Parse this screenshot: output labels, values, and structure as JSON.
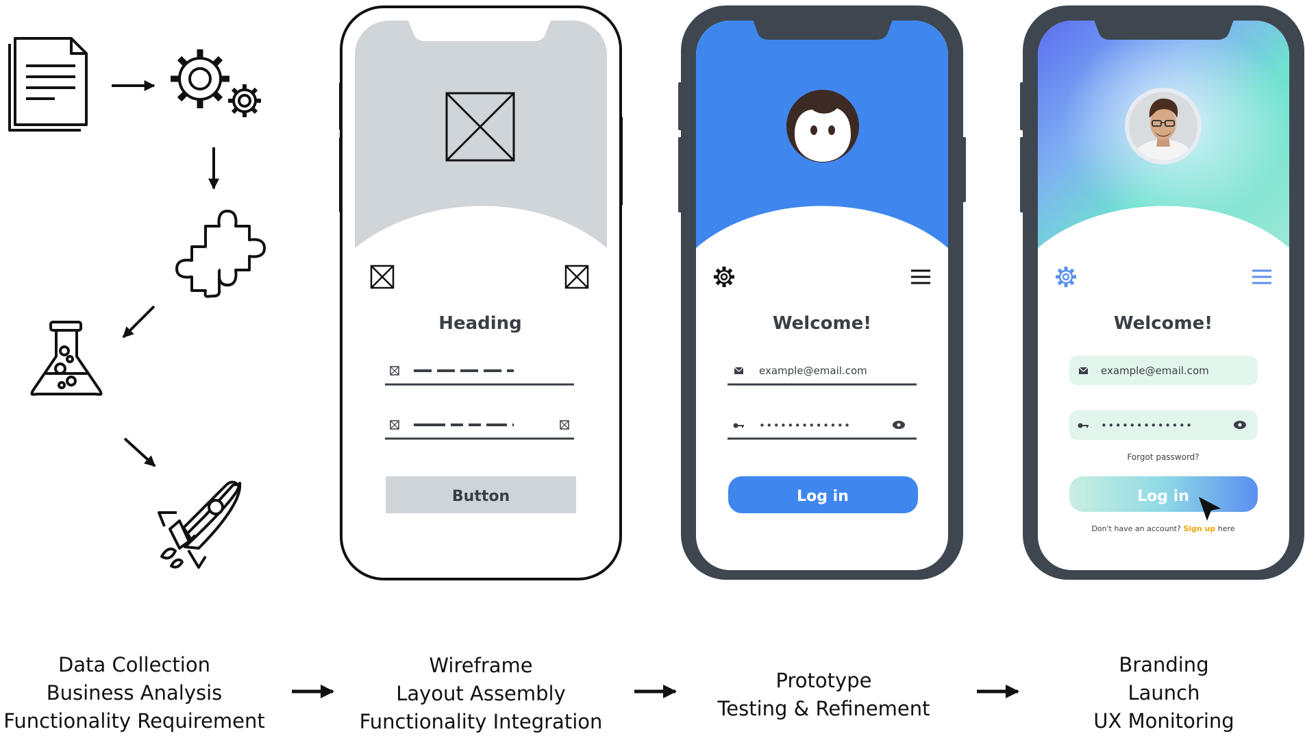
{
  "stages": [
    {
      "caption": [
        "Data Collection",
        "Business Analysis",
        "Functionality Requirement"
      ]
    },
    {
      "caption": [
        "Wireframe",
        "Layout Assembly",
        "Functionality Integration"
      ]
    },
    {
      "caption": [
        "Prototype",
        "Testing & Refinement"
      ]
    },
    {
      "caption": [
        "Branding",
        "Launch",
        "UX Monitoring"
      ]
    }
  ],
  "process_icons": [
    "document-icon",
    "gears-icon",
    "puzzle-icon",
    "flask-icon",
    "rocket-icon"
  ],
  "wireframe": {
    "heading": "Heading",
    "button": "Button"
  },
  "prototype": {
    "welcome": "Welcome!",
    "email_placeholder": "example@email.com",
    "password_mask": "•••••••••••••",
    "login": "Log in"
  },
  "branded": {
    "welcome": "Welcome!",
    "email_placeholder": "example@email.com",
    "password_mask": "•••••••••••••",
    "forgot": "Forgot password?",
    "login": "Log in",
    "signup_prefix": "Don't have an account?",
    "signup_link": "Sign up",
    "signup_suffix": "here"
  },
  "colors": {
    "prototype_blue": "#3f87ee",
    "wire_gray": "#d0d5da",
    "phone_frame": "#3e4650",
    "signup_link": "#f0a500"
  }
}
